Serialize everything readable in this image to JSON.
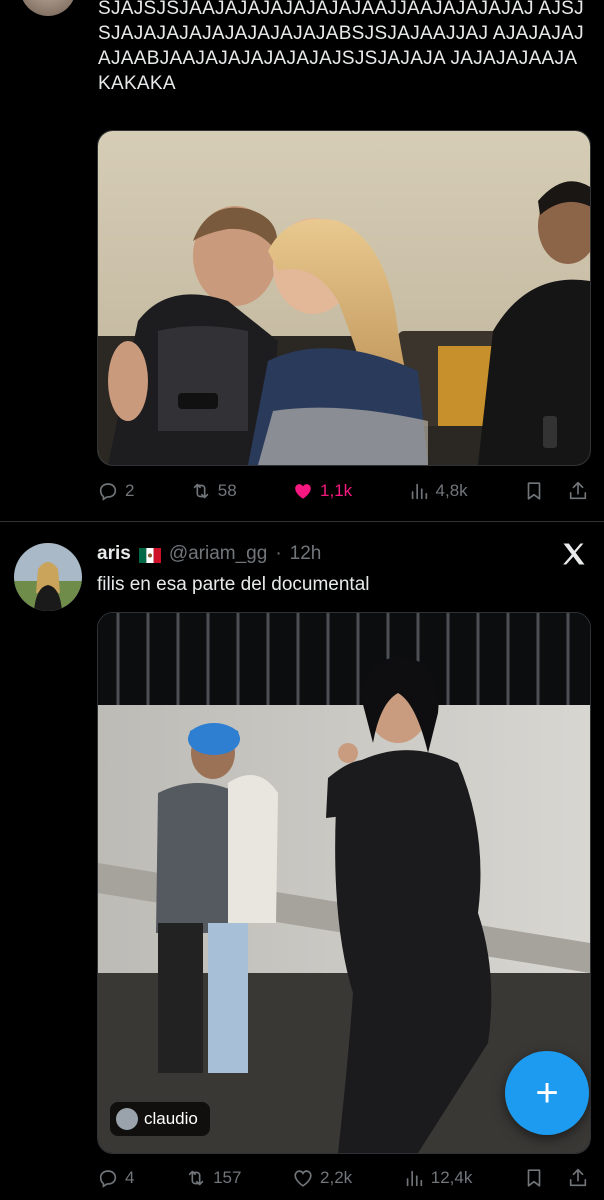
{
  "tweet1": {
    "text": "SJAJSJSJAAJAJAJAJAJAJAJAAJJAAJAJAJAJAJ AJSJSJAJAJAJAJAJAJAJAJAJABSJSJAJAAJJAJ AJAJAJAJAJAABJAAJAJAJAJAJAJAJSJSJAJAJA JAJAJAJAAJAKAKAKA",
    "replies": "2",
    "reposts": "58",
    "likes": "1,1k",
    "views": "4,8k"
  },
  "tweet2": {
    "name": "aris",
    "flag": "mexico-flag",
    "handle": "@ariam_gg",
    "separator": "·",
    "time": "12h",
    "text": "filis en esa parte del documental",
    "tag_label": "claudio",
    "replies": "4",
    "reposts": "157",
    "likes": "2,2k",
    "views": "12,4k"
  },
  "icons": {
    "reply": "reply-icon",
    "repost": "repost-icon",
    "like": "heart-icon",
    "views": "views-icon",
    "bookmark": "bookmark-icon",
    "share": "share-icon",
    "compose": "plus-icon",
    "brand": "x-logo-icon"
  },
  "colors": {
    "background": "#000000",
    "text": "#e7e9ea",
    "muted": "#71767b",
    "like_active": "#f91880",
    "accent": "#1d9bf0",
    "divider": "#2f3336"
  }
}
